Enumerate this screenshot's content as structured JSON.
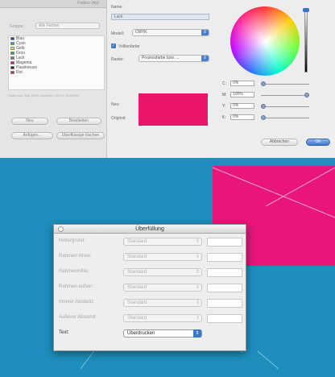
{
  "colors_window": {
    "title": "Farben (Ap)",
    "group_label": "Gruppe:",
    "group_value": "Alle Farben",
    "swatches": [
      {
        "label": "Blau",
        "color": "#1f3f9a"
      },
      {
        "label": "Cyan",
        "color": "#17a6d8"
      },
      {
        "label": "Gelb",
        "color": "#f2e31d"
      },
      {
        "label": "Grün",
        "color": "#2aa84a"
      },
      {
        "label": "Lack",
        "color": "#7a7a7a"
      },
      {
        "label": "Magenta",
        "color": "#e0157a"
      },
      {
        "label": "Passkreuze",
        "color": "#222222"
      },
      {
        "label": "Rot",
        "color": "#d9231f"
      }
    ],
    "note": "Farbe aus: Bild, RGB zuweisen. CMYK: 0/100/0/0",
    "buttons": {
      "new": "Neu",
      "edit": "Bearbeiten",
      "append": "Anfügen...",
      "unused": "Überflüssige löschen"
    }
  },
  "picker": {
    "name_label": "Name:",
    "name_value": "Lack",
    "model_label": "Modell:",
    "model_value": "CMYK",
    "spot_label": "Volltonfarbe",
    "spot_checked": true,
    "halftone_label": "Raster:",
    "halftone_value": "Prozessfarbe bzw. ...",
    "new_label": "Neu:",
    "original_label": "Original:",
    "swatch_color": "#e8156b",
    "channels": [
      {
        "label": "C:",
        "value": "0%",
        "level": 0.0
      },
      {
        "label": "M:",
        "value": "100%",
        "level": 1.0
      },
      {
        "label": "Y:",
        "value": "0%",
        "level": 0.0
      },
      {
        "label": "K:",
        "value": "0%",
        "level": 0.0
      }
    ],
    "cancel_label": "Abbrechen",
    "ok_label": "OK"
  },
  "dialog": {
    "title": "Überfüllung",
    "rows": [
      {
        "label": "Hintergrund:",
        "value": "Standard",
        "active": false
      },
      {
        "label": "Rahmen innen:",
        "value": "Standard",
        "active": false
      },
      {
        "label": "Rahmenmitte:",
        "value": "Standard",
        "active": false
      },
      {
        "label": "Rahmen außen:",
        "value": "Standard",
        "active": false
      },
      {
        "label": "Innerer Abstand:",
        "value": "Standard",
        "active": false
      },
      {
        "label": "Äußerer Abstand:",
        "value": "Standard",
        "active": false
      },
      {
        "label": "Text:",
        "value": "Überdrucken",
        "active": true
      }
    ]
  },
  "colors": {
    "workspace": "#1e8fbd",
    "accent_pink": "#e8157a"
  }
}
